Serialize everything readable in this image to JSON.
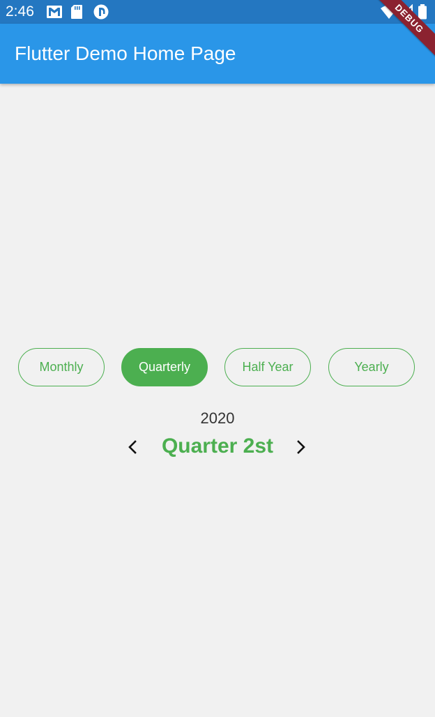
{
  "status_bar": {
    "time": "2:46",
    "icons": [
      "gmail-icon",
      "sd-card-icon",
      "app-notification-icon",
      "wifi-icon",
      "signal-icon",
      "battery-icon"
    ]
  },
  "app_bar": {
    "title": "Flutter Demo Home Page",
    "color": "#2a96e8"
  },
  "debug_banner": {
    "label": "DEBUG"
  },
  "period_selector": {
    "options": [
      {
        "label": "Monthly",
        "selected": false
      },
      {
        "label": "Quarterly",
        "selected": true
      },
      {
        "label": "Half Year",
        "selected": false
      },
      {
        "label": "Yearly",
        "selected": false
      }
    ],
    "accent_color": "#4caf50"
  },
  "period_display": {
    "year": "2020",
    "period_label": "Quarter 2st",
    "prev_icon": "chevron-left-icon",
    "next_icon": "chevron-right-icon"
  }
}
